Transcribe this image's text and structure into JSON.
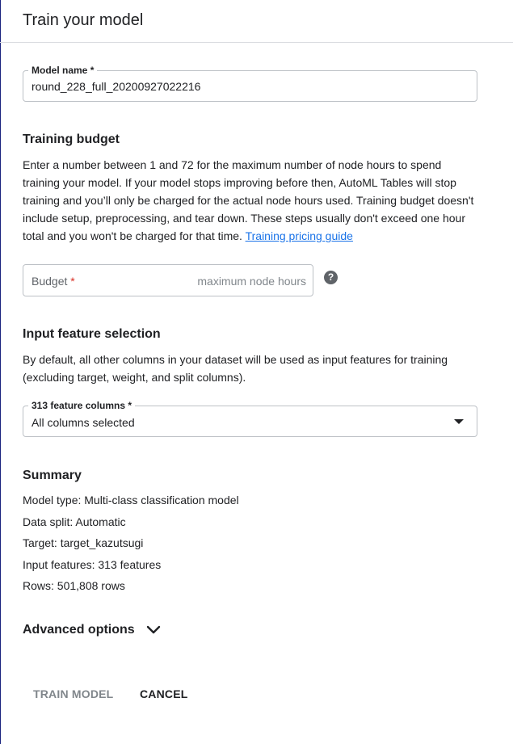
{
  "dialog": {
    "title": "Train your model"
  },
  "model_name": {
    "label": "Model name",
    "required_mark": "*",
    "value": "round_228_full_20200927022216"
  },
  "training_budget": {
    "heading": "Training budget",
    "description": "Enter a number between 1 and 72 for the maximum number of node hours to spend training your model. If your model stops improving before then, AutoML Tables will stop training and you’ll only be charged for the actual node hours used. Training budget doesn't include setup, preprocessing, and tear down. These steps usually don't exceed one hour total and you won't be charged for that time.",
    "link_text": "Training pricing guide",
    "budget_label": "Budget",
    "required_mark": "*",
    "budget_placeholder": "maximum node hours",
    "help_glyph": "?"
  },
  "input_feature_selection": {
    "heading": "Input feature selection",
    "description": "By default, all other columns in your dataset will be used as input features for training (excluding target, weight, and split columns).",
    "select_label": "313 feature columns",
    "required_mark": "*",
    "selected_value": "All columns selected"
  },
  "summary": {
    "heading": "Summary",
    "lines": [
      "Model type: Multi-class classification model",
      "Data split: Automatic",
      "Target: target_kazutsugi",
      "Input features: 313 features",
      "Rows: 501,808 rows"
    ]
  },
  "advanced_options": {
    "label": "Advanced options",
    "icon": "chevron-down-icon"
  },
  "actions": {
    "train_label": "TRAIN MODEL",
    "cancel_label": "CANCEL"
  },
  "colors": {
    "link": "#1a73e8",
    "required": "#d93025",
    "disabled_text": "#80868b",
    "border": "#bdc1c6"
  }
}
